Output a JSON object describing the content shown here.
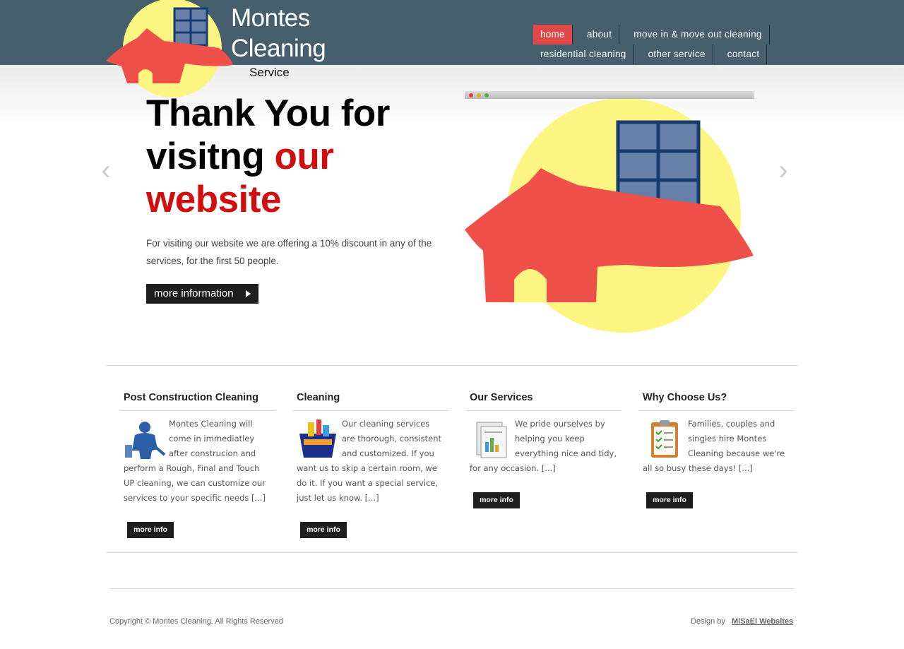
{
  "logo": {
    "line1": "Montes",
    "line2": "Cleaning",
    "line3": "Service"
  },
  "nav": {
    "row1": [
      "home",
      "about",
      "move in & move out cleaning"
    ],
    "row2": [
      "residential cleaning",
      "other service",
      "contact"
    ]
  },
  "hero": {
    "headline_black": "Thank You for visitng",
    "headline_red": "our website",
    "description": "For visiting our website we are offering a 10% discount in any of the services, for the first 50 people.",
    "button": "more information",
    "prev_arrow": "‹",
    "next_arrow": "›"
  },
  "columns": [
    {
      "title": "Post Construction Cleaning",
      "icon": "worker-icon",
      "text": "Montes Cleaning will come in immediatley after construcion and perform a Rough, Final and Touch UP cleaning, we can customize our services to your specific needs [...]",
      "button": "more info"
    },
    {
      "title": "Cleaning",
      "icon": "cleaning-supplies-icon",
      "text": "Our cleaning services are thorough, consistent and customized. If you want us to skip a certain room, we do it. If you want a special service, just let us know. [...]",
      "button": "more info"
    },
    {
      "title": "Our Services",
      "icon": "report-icon",
      "text": "We pride ourselves by helping you keep everything nice and tidy, for any occasion. [...]",
      "button": "more info"
    },
    {
      "title": "Why Choose Us?",
      "icon": "clipboard-icon",
      "text": "Families, couples and singles hire Montes Cleaning because we're all so busy these days! [...]",
      "button": "more info"
    }
  ],
  "footer": {
    "copyright": "Copyright © Montes Cleaning. All Rights Reserved",
    "design_by": "Design by",
    "designer": "MiSaEl Websites"
  },
  "colors": {
    "header": "#465f6d",
    "accent": "#e04848",
    "house": "#f0504a",
    "sun": "#fdf582",
    "window": "#6680aa"
  }
}
